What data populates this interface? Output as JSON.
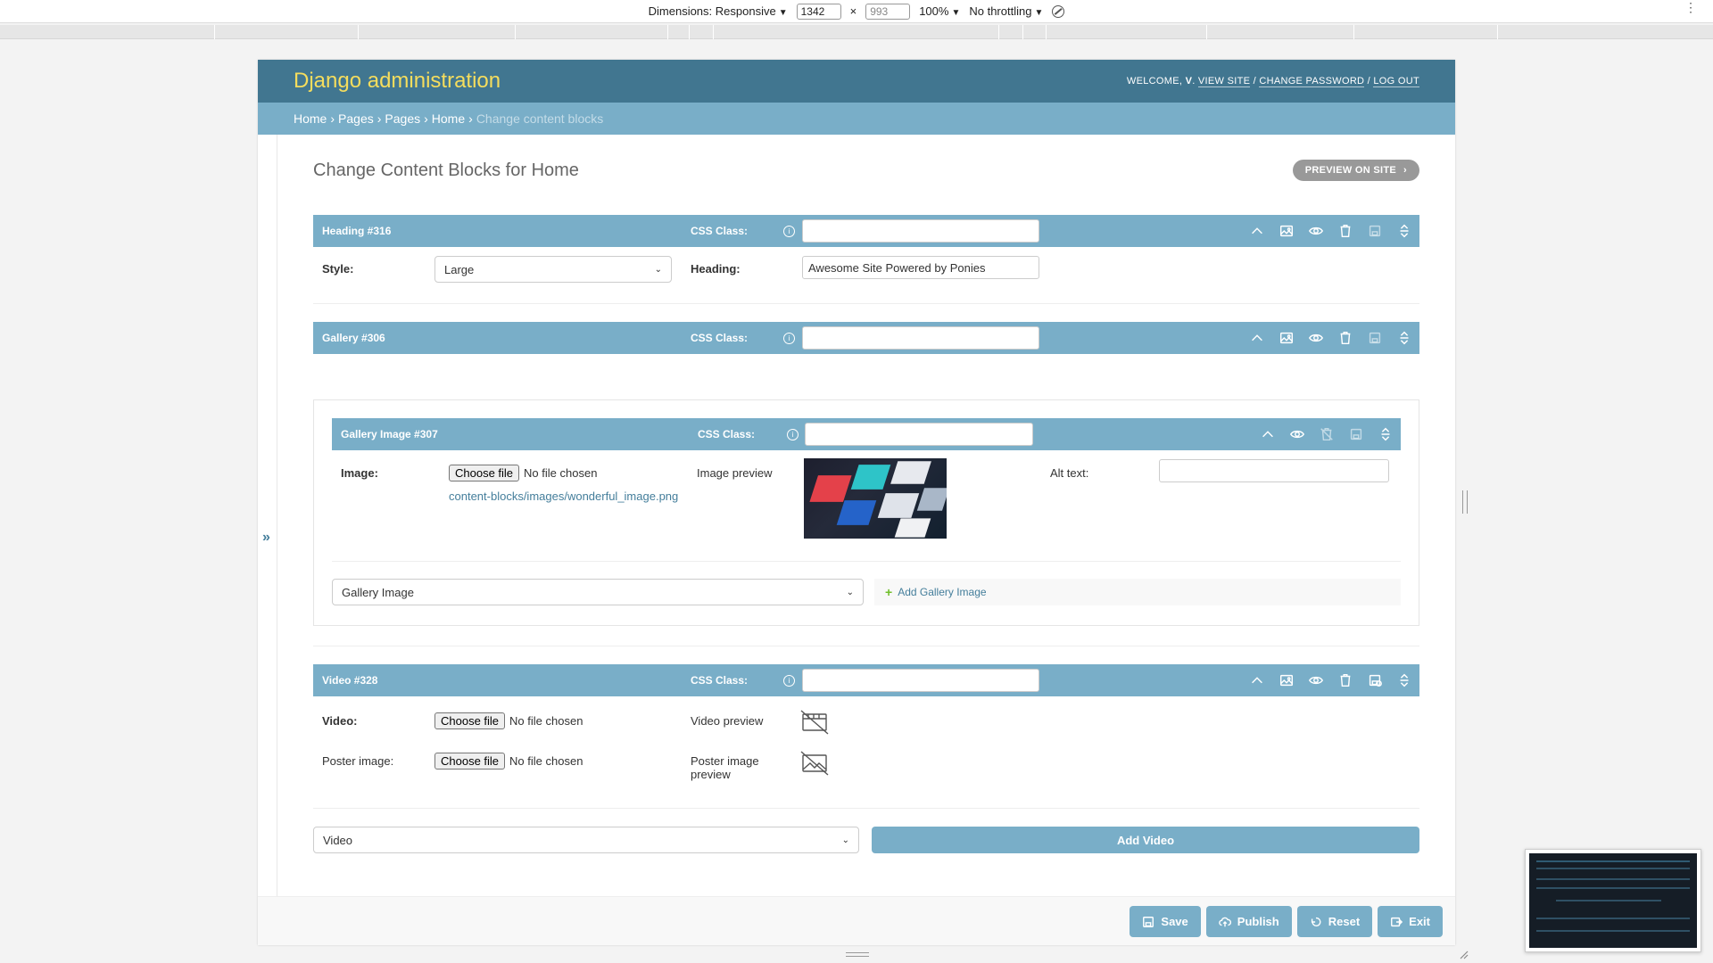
{
  "devtools": {
    "dimensions_label": "Dimensions: Responsive",
    "width": "1342",
    "height": "993",
    "zoom": "100%",
    "throttling": "No throttling"
  },
  "header": {
    "brand": "Django administration",
    "welcome": "Welcome,",
    "user": "V",
    "view_site": "View site",
    "change_password": "Change password",
    "log_out": "Log out"
  },
  "breadcrumbs": [
    "Home",
    "Pages",
    "Pages",
    "Home",
    "Change content blocks"
  ],
  "page": {
    "title": "Change Content Blocks for Home",
    "preview_button": "Preview on site"
  },
  "blocks": {
    "heading": {
      "title": "Heading #316",
      "css_label": "CSS Class:",
      "style_label": "Style:",
      "style_value": "Large",
      "heading_label": "Heading:",
      "heading_value": "Awesome Site Powered by Ponies"
    },
    "gallery": {
      "title": "Gallery #306",
      "css_label": "CSS Class:"
    },
    "gallery_image": {
      "title": "Gallery Image #307",
      "css_label": "CSS Class:",
      "image_label": "Image:",
      "choose_file": "Choose file",
      "no_file": "No file chosen",
      "current_file": "content-blocks/images/wonderful_image.png",
      "preview_label": "Image preview",
      "alt_label": "Alt text:",
      "add_select": "Gallery Image",
      "add_link": "Add Gallery Image"
    },
    "video": {
      "title": "Video #328",
      "css_label": "CSS Class:",
      "video_label": "Video:",
      "choose_file": "Choose file",
      "no_file": "No file chosen",
      "video_preview": "Video preview",
      "poster_label": "Poster image:",
      "poster_preview_1": "Poster image",
      "poster_preview_2": "preview"
    },
    "add_block": {
      "select_value": "Video",
      "button": "Add Video"
    }
  },
  "footer": {
    "save": "Save",
    "publish": "Publish",
    "reset": "Reset",
    "exit": "Exit"
  },
  "colors": {
    "header": "#417690",
    "breadcrumbs": "#79aec8",
    "brand": "#f5dd5d",
    "link": "#447e9b"
  }
}
